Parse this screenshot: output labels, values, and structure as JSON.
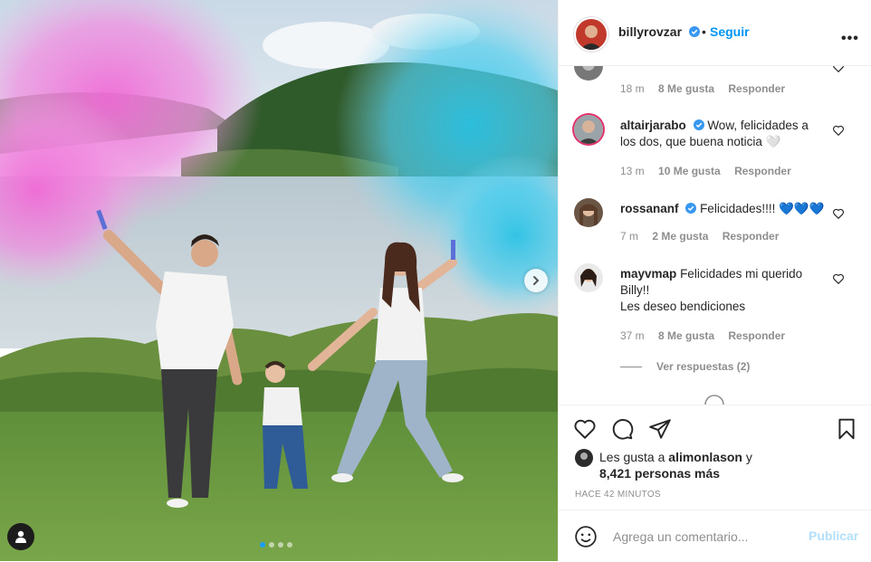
{
  "post": {
    "author": "billyrovzar",
    "follow_label": "Seguir",
    "separator": "•",
    "more_label": "•••"
  },
  "comments": [
    {
      "user": "",
      "text": "",
      "time": "18 m",
      "likes": "8 Me gusta",
      "reply": "Responder"
    },
    {
      "user": "altairjarabo",
      "verified": true,
      "text": "Wow, felicidades a los dos, que buena noticia 🤍",
      "time": "13 m",
      "likes": "10 Me gusta",
      "reply": "Responder"
    },
    {
      "user": "rossananf",
      "verified": true,
      "text": "Felicidades!!!! 💙💙💙",
      "time": "7 m",
      "likes": "2 Me gusta",
      "reply": "Responder"
    },
    {
      "user": "mayvmap",
      "verified": false,
      "text": "Felicidades mi querido Billy!!",
      "text2": "Les deseo bendiciones",
      "time": "37 m",
      "likes": "8 Me gusta",
      "reply": "Responder"
    }
  ],
  "view_replies": "Ver respuestas (2)",
  "likes": {
    "prefix": "Les gusta a",
    "user": "alimonlason",
    "suffix": "y",
    "others": "8,421 personas más"
  },
  "timestamp": "HACE 42 MINUTOS",
  "add_comment": {
    "placeholder": "Agrega un comentario...",
    "publish_label": "Publicar"
  },
  "colors": {
    "accent": "#0095f6",
    "publish_disabled": "#b2dffc",
    "verified": "#3897f0",
    "smoke_pink": "#f27ad9",
    "smoke_blue": "#3fc7e8"
  },
  "carousel": {
    "slides": 4,
    "active": 1
  },
  "icons": [
    "verified-icon",
    "more-options-icon",
    "heart-icon",
    "comment-icon",
    "share-icon",
    "save-icon",
    "emoji-icon",
    "chevron-right-icon",
    "user-tag-icon"
  ]
}
